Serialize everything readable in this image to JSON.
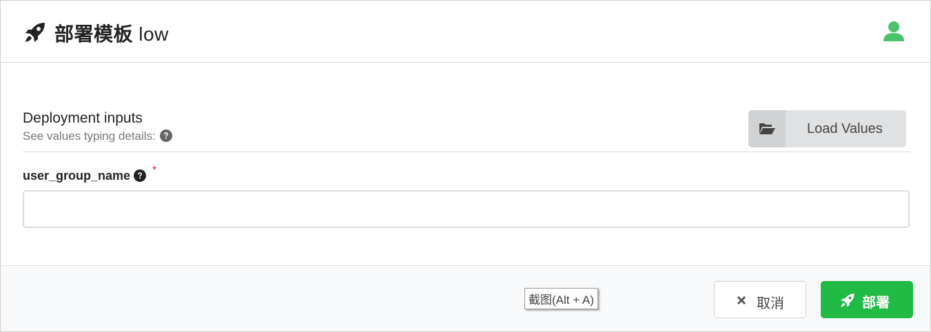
{
  "header": {
    "title": "部署模板",
    "blueprint_name": "low",
    "icon": "rocket-icon",
    "user_icon": "user-icon",
    "user_icon_color": "#4ac26b"
  },
  "inputs": {
    "section_title": "Deployment inputs",
    "section_subtitle": "See values typing details:",
    "load_values_label": "Load Values",
    "load_values_icon": "folder-open-icon"
  },
  "fields": [
    {
      "label": "user_group_name",
      "required_mark": "*",
      "value": "",
      "placeholder": ""
    }
  ],
  "footer": {
    "tooltip": "截图(Alt + A)",
    "cancel_label": "取消",
    "cancel_icon": "close-icon",
    "deploy_label": "部署",
    "deploy_icon": "rocket-icon",
    "deploy_color": "#21ba45"
  }
}
